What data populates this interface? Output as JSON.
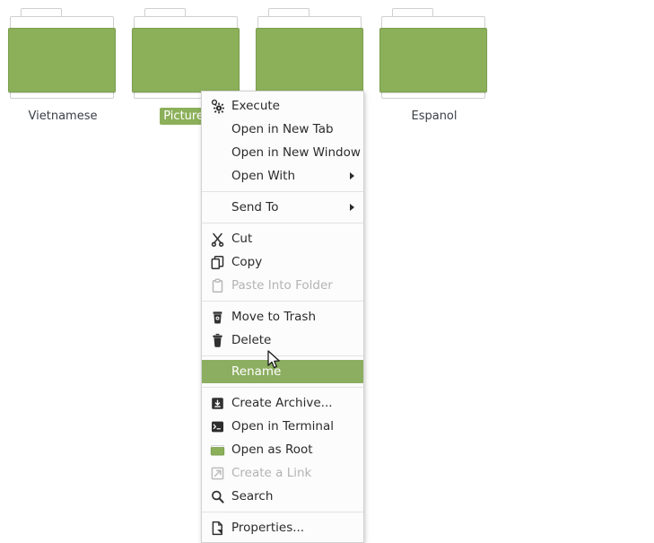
{
  "desktop": {
    "background_color": "#ffffff",
    "folder_color": "#8cb05a",
    "files": [
      {
        "name": "Vietnamese",
        "selected": false,
        "icon": "folder-icon"
      },
      {
        "name": "Pictures",
        "selected": true,
        "icon": "folder-icon"
      },
      {
        "name": "",
        "selected": false,
        "icon": "folder-icon"
      },
      {
        "name": "Espanol",
        "selected": false,
        "icon": "folder-icon"
      }
    ]
  },
  "context_menu": {
    "highlight_color": "#8cae60",
    "groups": [
      {
        "items": [
          {
            "label": "Execute",
            "icon": "gear-execute-icon",
            "state": "normal",
            "submenu": false
          },
          {
            "label": "Open in New Tab",
            "icon": "none",
            "state": "normal",
            "submenu": false
          },
          {
            "label": "Open in New Window",
            "icon": "none",
            "state": "normal",
            "submenu": false
          },
          {
            "label": "Open With",
            "icon": "none",
            "state": "normal",
            "submenu": true
          }
        ]
      },
      {
        "items": [
          {
            "label": "Send To",
            "icon": "none",
            "state": "normal",
            "submenu": true
          }
        ]
      },
      {
        "items": [
          {
            "label": "Cut",
            "icon": "scissors-icon",
            "state": "normal",
            "submenu": false
          },
          {
            "label": "Copy",
            "icon": "copy-icon",
            "state": "normal",
            "submenu": false
          },
          {
            "label": "Paste Into Folder",
            "icon": "clipboard-icon",
            "state": "disabled",
            "submenu": false
          }
        ]
      },
      {
        "items": [
          {
            "label": "Move to Trash",
            "icon": "trash-can-icon",
            "state": "normal",
            "submenu": false
          },
          {
            "label": "Delete",
            "icon": "delete-bin-icon",
            "state": "normal",
            "submenu": false
          }
        ]
      },
      {
        "items": [
          {
            "label": "Rename",
            "icon": "none",
            "state": "highlighted",
            "submenu": false
          }
        ]
      },
      {
        "items": [
          {
            "label": "Create Archive...",
            "icon": "archive-icon",
            "state": "normal",
            "submenu": false
          },
          {
            "label": "Open in Terminal",
            "icon": "terminal-icon",
            "state": "normal",
            "submenu": false
          },
          {
            "label": "Open as Root",
            "icon": "folder-green-icon",
            "state": "normal",
            "submenu": false
          },
          {
            "label": "Create a Link",
            "icon": "link-arrow-icon",
            "state": "disabled",
            "submenu": false
          },
          {
            "label": "Search",
            "icon": "search-icon",
            "state": "normal",
            "submenu": false
          }
        ]
      },
      {
        "items": [
          {
            "label": "Properties...",
            "icon": "properties-icon",
            "state": "normal",
            "submenu": false
          }
        ]
      }
    ]
  },
  "pointer": {
    "type": "arrow-cursor"
  }
}
